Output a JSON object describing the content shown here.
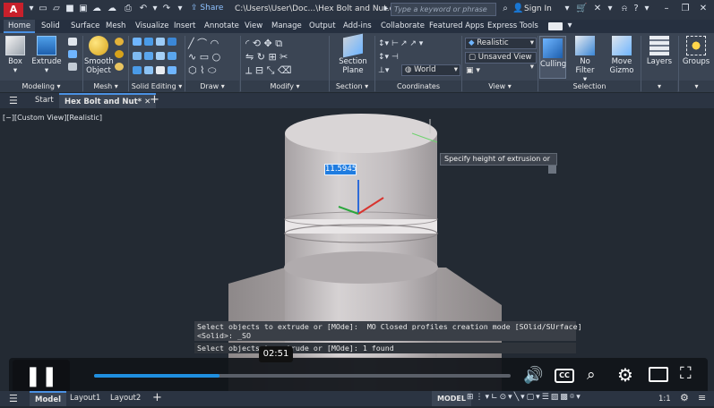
{
  "app": {
    "logo": "A",
    "share_label": "Share",
    "file_path": "C:\\Users\\User\\Doc...\\Hex Bolt and Nut.dwg",
    "search_placeholder": "Type a keyword or phrase",
    "signin_label": "Sign In"
  },
  "ribbon_tabs": [
    "Home",
    "Solid",
    "Surface",
    "Mesh",
    "Visualize",
    "Insert",
    "Annotate",
    "View",
    "Manage",
    "Output",
    "Add-ins",
    "Collaborate",
    "Featured Apps",
    "Express Tools"
  ],
  "ribbon": {
    "box": "Box",
    "extrude": "Extrude",
    "smooth_object": "Smooth\nObject",
    "section_plane": "Section\nPlane",
    "visual_style": "Realistic",
    "view_state": "Unsaved View",
    "ucs": "World",
    "culling": "Culling",
    "no_filter": "No Filter",
    "move_gizmo": "Move\nGizmo",
    "layers": "Layers",
    "groups": "Groups",
    "panels": {
      "modeling": "Modeling",
      "mesh": "Mesh",
      "solid_editing": "Solid Editing",
      "draw": "Draw",
      "modify": "Modify",
      "section": "Section",
      "coordinates": "Coordinates",
      "view": "View",
      "selection": "Selection"
    }
  },
  "file_tabs": {
    "start": "Start",
    "active": "Hex Bolt and Nut*"
  },
  "viewport": {
    "label": "[−][Custom View][Realistic]",
    "tooltip": "Specify height of extrusion or",
    "dimension_value": "11.5945"
  },
  "command_history": [
    "Select objects to extrude or [MOde]: _MO Closed profiles creation mode [SOlid/SUrface]",
    "<Solid>: _SO",
    "Select objects to extrude or [MOde]: 1 found"
  ],
  "video": {
    "time": "02:51",
    "progress": 0.3,
    "pause_icon": "pause-icon",
    "volume_icon": "volume-icon",
    "cc_label": "CC"
  },
  "status": {
    "model_tab": "Model",
    "layout1": "Layout1",
    "layout2": "Layout2",
    "model_button": "MODEL",
    "scale": "1:1"
  },
  "colors": {
    "accent": "#1f7ce0",
    "ribbon_bg": "#3b4554",
    "viewport_bg": "#232a33",
    "autocad_red": "#c8202b"
  }
}
